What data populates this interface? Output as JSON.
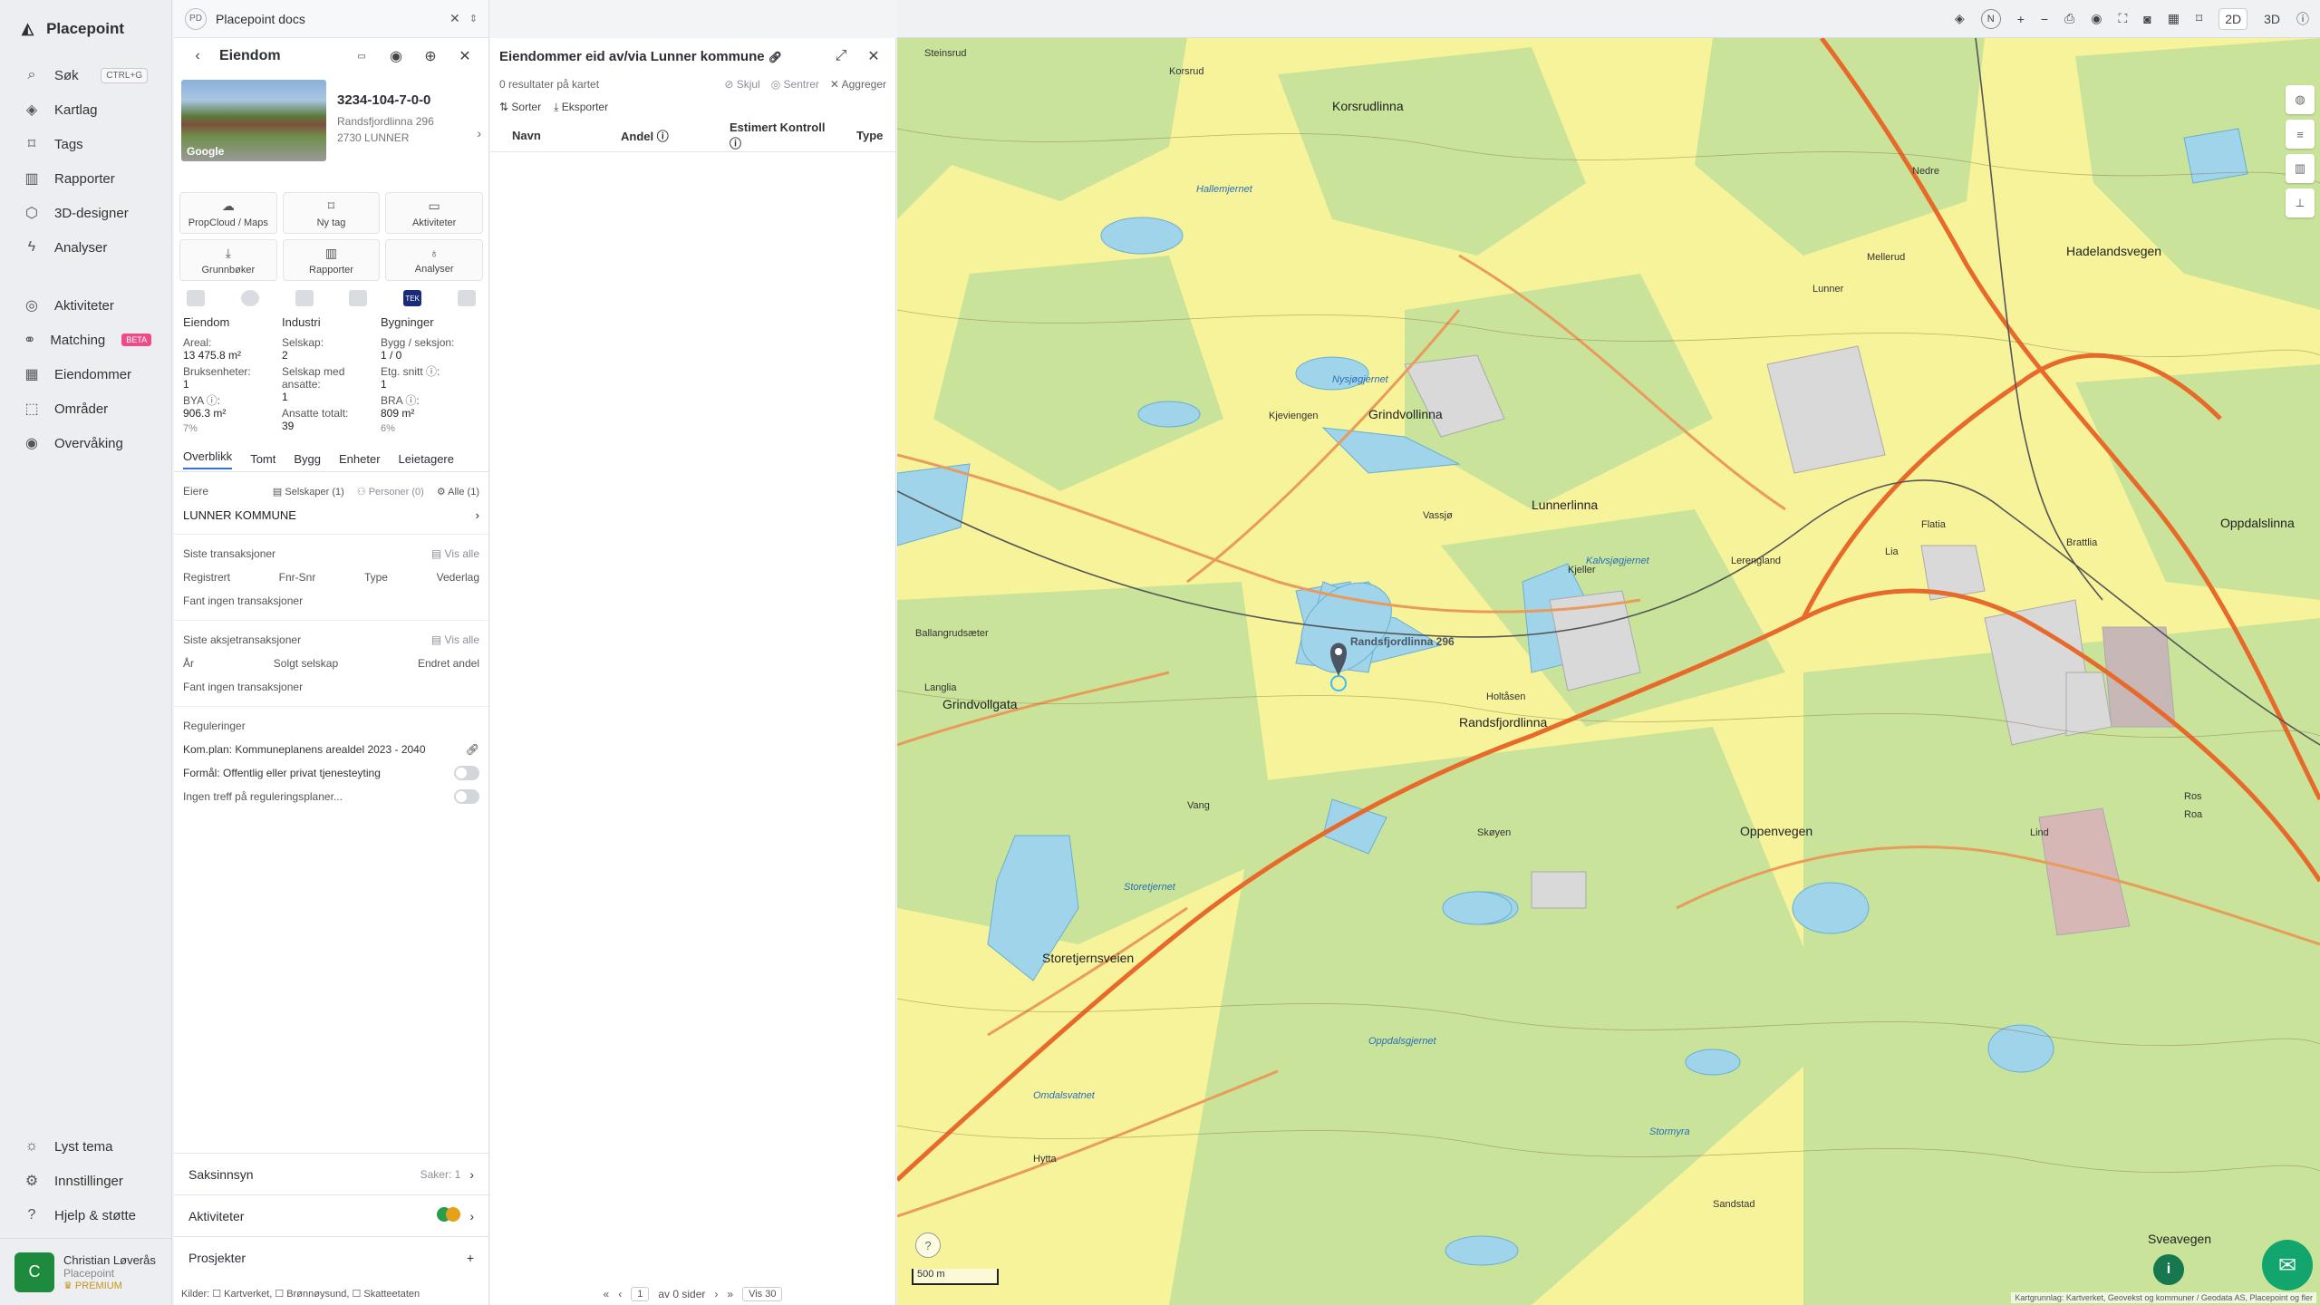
{
  "brand": "Placepoint",
  "nav": [
    {
      "icon": "search-icon",
      "glyph": "⌕",
      "label": "Søk",
      "kbd": "CTRL+G"
    },
    {
      "icon": "layers-icon",
      "glyph": "◈",
      "label": "Kartlag"
    },
    {
      "icon": "bookmark-icon",
      "glyph": "⌑",
      "label": "Tags"
    },
    {
      "icon": "chart-icon",
      "glyph": "▥",
      "label": "Rapporter"
    },
    {
      "icon": "cube-icon",
      "glyph": "⬡",
      "label": "3D-designer"
    },
    {
      "icon": "bolt-icon",
      "glyph": "ϟ",
      "label": "Analyser"
    },
    {
      "icon": "chat-icon",
      "glyph": "◎",
      "label": "Aktiviteter"
    },
    {
      "icon": "matching-icon",
      "glyph": "⚭",
      "label": "Matching",
      "badge": "BETA"
    },
    {
      "icon": "building-icon",
      "glyph": "▦",
      "label": "Eiendommer"
    },
    {
      "icon": "area-icon",
      "glyph": "⬚",
      "label": "Områder"
    },
    {
      "icon": "monitor-icon",
      "glyph": "◉",
      "label": "Overvåking"
    }
  ],
  "navBottom": [
    {
      "icon": "sun-icon",
      "glyph": "☼",
      "label": "Lyst tema"
    },
    {
      "icon": "gear-icon",
      "glyph": "⚙",
      "label": "Innstillinger"
    },
    {
      "icon": "help-icon",
      "glyph": "?",
      "label": "Hjelp & støtte"
    }
  ],
  "user": {
    "initial": "C",
    "name": "Christian Løverås",
    "org": "Placepoint",
    "plan": "PREMIUM"
  },
  "doc": {
    "badge": "PD",
    "title": "Placepoint docs"
  },
  "property": {
    "header": "Eiendom",
    "id": "3234-104-7-0-0",
    "street": "Randsfjordlinna 296",
    "city": "2730 LUNNER",
    "photoCredit": "Google",
    "actions": [
      {
        "icon": "propcloud-icon",
        "glyph": "☁",
        "label": "PropCloud / Maps"
      },
      {
        "icon": "tag-icon",
        "glyph": "⌑",
        "label": "Ny tag"
      },
      {
        "icon": "activity-icon",
        "glyph": "▭",
        "label": "Aktiviteter"
      },
      {
        "icon": "download-icon",
        "glyph": "⤓",
        "label": "Grunnbøker"
      },
      {
        "icon": "report-icon",
        "glyph": "▥",
        "label": "Rapporter"
      },
      {
        "icon": "analysis-icon",
        "glyph": "♁",
        "label": "Analyser"
      }
    ],
    "sourceTek": "TEK",
    "stats": [
      {
        "head": "Eiendom",
        "items": [
          {
            "l": "Areal:",
            "v": "13 475.8 m²"
          },
          {
            "l": "Bruksenheter:",
            "v": "1"
          },
          {
            "l": "BYA ⓘ:",
            "v": "906.3 m²",
            "p": "7%"
          }
        ]
      },
      {
        "head": "Industri",
        "items": [
          {
            "l": "Selskap:",
            "v": "2"
          },
          {
            "l": "Selskap med ansatte:",
            "v": "1"
          },
          {
            "l": "Ansatte totalt:",
            "v": "39"
          }
        ]
      },
      {
        "head": "Bygninger",
        "items": [
          {
            "l": "Bygg / seksjon:",
            "v": "1 / 0"
          },
          {
            "l": "Etg. snitt ⓘ:",
            "v": "1"
          },
          {
            "l": "BRA ⓘ:",
            "v": "809 m²",
            "p": "6%"
          }
        ]
      }
    ],
    "tabs": [
      "Overblikk",
      "Tomt",
      "Bygg",
      "Enheter",
      "Leietagere"
    ],
    "owners": {
      "label": "Eiere",
      "companies": "Selskaper (1)",
      "persons": "Personer (0)",
      "all": "Alle (1)",
      "owner": "LUNNER KOMMUNE"
    },
    "transactions": {
      "title": "Siste transaksjoner",
      "viewAll": "Vis alle",
      "cols": [
        "Registrert",
        "Fnr-Snr",
        "Type",
        "Vederlag"
      ],
      "empty": "Fant ingen transaksjoner"
    },
    "shareTransactions": {
      "title": "Siste aksjetransaksjoner",
      "viewAll": "Vis alle",
      "cols": [
        "År",
        "Solgt selskap",
        "Endret andel"
      ],
      "empty": "Fant ingen transaksjoner"
    },
    "regulations": {
      "title": "Reguleringer",
      "plan": "Kom.plan: Kommuneplanens arealdel 2023 - 2040",
      "purpose": "Formål: Offentlig eller privat tjenesteyting",
      "noMatch": "Ingen treff på reguleringsplaner..."
    },
    "bottom": [
      {
        "label": "Saksinnsyn",
        "meta": "Saker: 1",
        "arrow": "›"
      },
      {
        "label": "Aktiviteter",
        "meta": "",
        "arrow": "›"
      },
      {
        "label": "Prosjekter",
        "meta": "",
        "arrow": "+"
      }
    ],
    "sources": "Kilder: ☐ Kartverket, ☐ Brønnøysund, ☐ Skatteetaten"
  },
  "owned": {
    "title": "Eiendommer eid av/via Lunner kommune",
    "count": "0 resultater på kartet",
    "hide": "Skjul",
    "center": "Sentrer",
    "aggregate": "Aggreger",
    "sort": "Sorter",
    "export": "Eksporter",
    "cols": [
      "Navn",
      "Andel ⓘ",
      "Estimert Kontroll ⓘ",
      "Type"
    ],
    "pager": {
      "page": "1",
      "of": "av 0 sider",
      "show": "Vis 30"
    }
  },
  "mapTools": {
    "mode2d": "2D",
    "mode3d": "3D",
    "north": "N"
  },
  "map": {
    "scale": "500 m",
    "pin": "Randsfjordlinna 296",
    "attribution": "Kartgrunnlag: Kartverket, Geovekst og kommuner / Geodata AS, Placepoint og fler",
    "places": [
      "Steinsrud",
      "Korsrud",
      "Korsrudlinna",
      "Nedre",
      "Lunner",
      "Grindvollinna",
      "Kjeller",
      "Lunnerlinna",
      "Randsfjordlinna",
      "Grindvollgata",
      "Lerengland",
      "Oppenvegen",
      "Hadelandsvegen",
      "Oppdalslinna",
      "Sveavegen",
      "Storetjernsveien",
      "Hallemjernet",
      "Kjeviengen",
      "Nysjøgjernet",
      "Kalvsjøgjernet",
      "Storetjernet",
      "Stormyra",
      "Omdalsvatnet",
      "Oppdalsgjernet",
      "Ballangrudsæter",
      "Langlia",
      "Holtåsen",
      "Vassjø",
      "Mellerud",
      "Vang",
      "Skøyen",
      "Flatia",
      "Brattlia",
      "Lia",
      "Lind",
      "Sandstad",
      "Hytta",
      "Ros",
      "Roa"
    ]
  }
}
